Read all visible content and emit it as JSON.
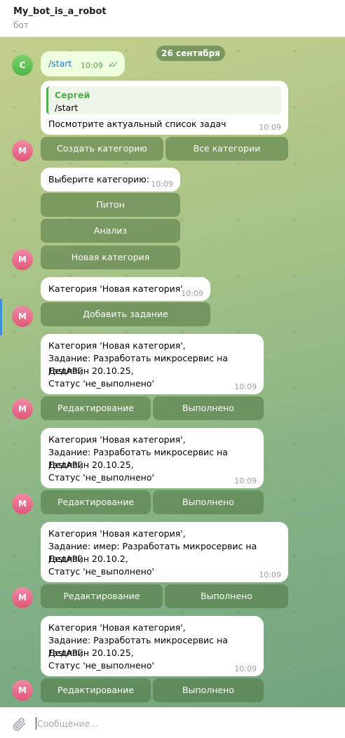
{
  "header": {
    "title": "My_bot_is_a_robot",
    "subtitle": "бот"
  },
  "input": {
    "placeholder": "Сообщение..."
  },
  "chat": {
    "date": "26 сентября",
    "user_avatar": "С",
    "bot_avatar": "М",
    "m0": {
      "text": "/start",
      "time": "10:09",
      "status": "read"
    },
    "m1": {
      "reply_name": "Сергей",
      "reply_text": "/start",
      "text": "Посмотрите актуальный список задач",
      "time": "10:09",
      "buttons": [
        "Создать категорию",
        "Все категории"
      ]
    },
    "m2": {
      "text": "Выберите категорию:",
      "time": "10:09",
      "buttons": [
        "Питон",
        "Анализ",
        "Новая категория"
      ]
    },
    "m3": {
      "text": "Категория 'Новая категория'",
      "time": "10:09",
      "buttons": [
        "Добавить задание"
      ]
    },
    "m4": {
      "lines": [
        "Категория 'Новая категория',",
        "Задание: Разработать микросервис на FastAPI,",
        "Дедлайн 20.10.25,",
        "Статус 'не_выполнено'"
      ],
      "time": "10:09",
      "buttons": [
        "Редактирование",
        "Выполнено"
      ]
    },
    "m5": {
      "lines": [
        "Категория 'Новая категория',",
        "Задание: Разработать микросервис на FastAPI,",
        "Дедлайн 20.10.25,",
        "Статус 'не_выполнено'"
      ],
      "time": "10:09",
      "buttons": [
        "Редактирование",
        "Выполнено"
      ]
    },
    "m6": {
      "lines": [
        "Категория 'Новая категория',",
        "Задание: имер: Разработать микросервис на FastAPI,",
        "Дедлайн 20.10.2,",
        "Статус 'не_выполнено'"
      ],
      "time": "10:09",
      "buttons": [
        "Редактирование",
        "Выполнено"
      ]
    },
    "m7": {
      "lines": [
        "Категория 'Новая категория',",
        "Задание: Разработать микросервис на FastAPI,",
        "Дедлайн 20.10.25,",
        "Статус 'не_выполнено'"
      ],
      "time": "10:09",
      "buttons": [
        "Редактирование",
        "Выполнено"
      ]
    }
  },
  "icons": {
    "attach": "paperclip-icon",
    "read_status": "double-check-icon"
  },
  "colors": {
    "bubble_in": "#ffffff",
    "bubble_out": "#eeffde",
    "accent_green": "#4fae4e",
    "link_blue": "#2a7abf",
    "keyboard_button": "#5f8a50"
  }
}
